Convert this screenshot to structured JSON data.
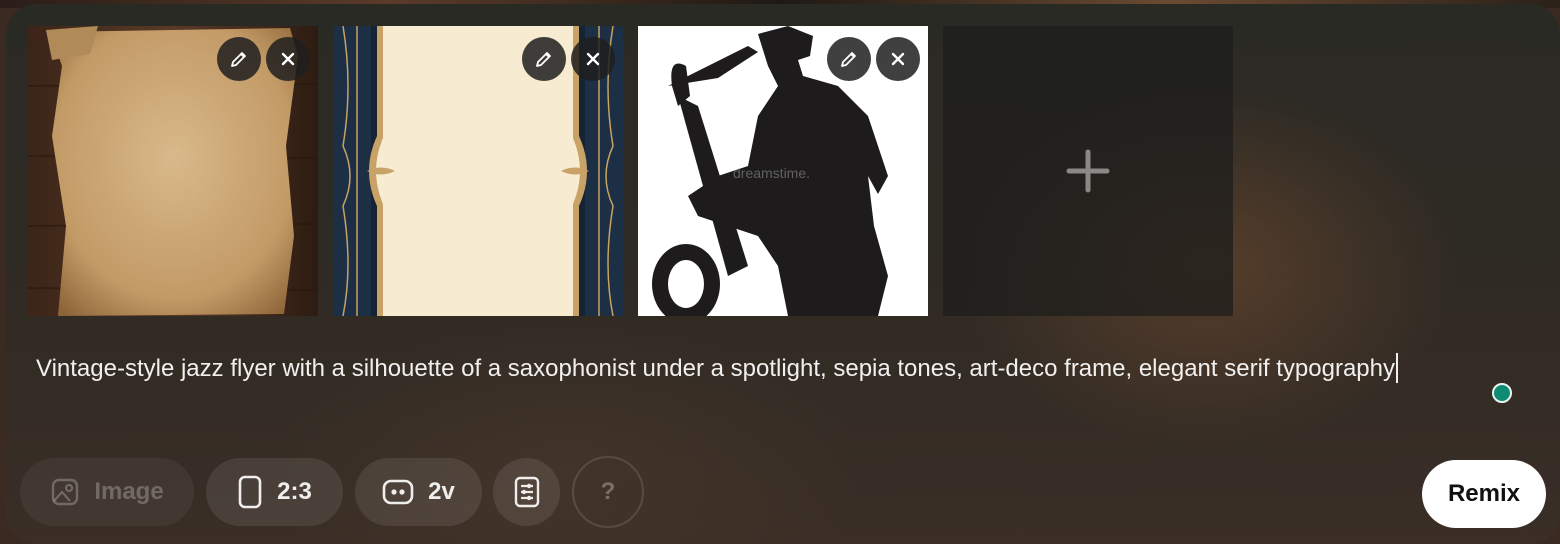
{
  "thumbnails": [
    {
      "name": "aged paper",
      "edit_icon": "pencil-icon",
      "remove_icon": "close-icon"
    },
    {
      "name": "art-deco frame",
      "edit_icon": "pencil-icon",
      "remove_icon": "close-icon"
    },
    {
      "name": "saxophonist silhouette",
      "watermark": "dreamstime.",
      "edit_icon": "pencil-icon",
      "remove_icon": "close-icon"
    }
  ],
  "add_slot": {
    "icon": "plus-icon"
  },
  "prompt": {
    "text": "Vintage-style jazz flyer with a silhouette of a saxophonist under a spotlight, sepia tones, art-deco frame, elegant serif typography"
  },
  "status_dot_color": "#0f8a73",
  "toolbar": {
    "image_label": "Image",
    "image_icon": "image-icon",
    "aspect_label": "2:3",
    "aspect_icon": "portrait-ratio-icon",
    "version_label": "2v",
    "version_icon": "model-icon",
    "settings_icon": "settings-sliders-icon",
    "help_label": "?",
    "remix_label": "Remix"
  }
}
